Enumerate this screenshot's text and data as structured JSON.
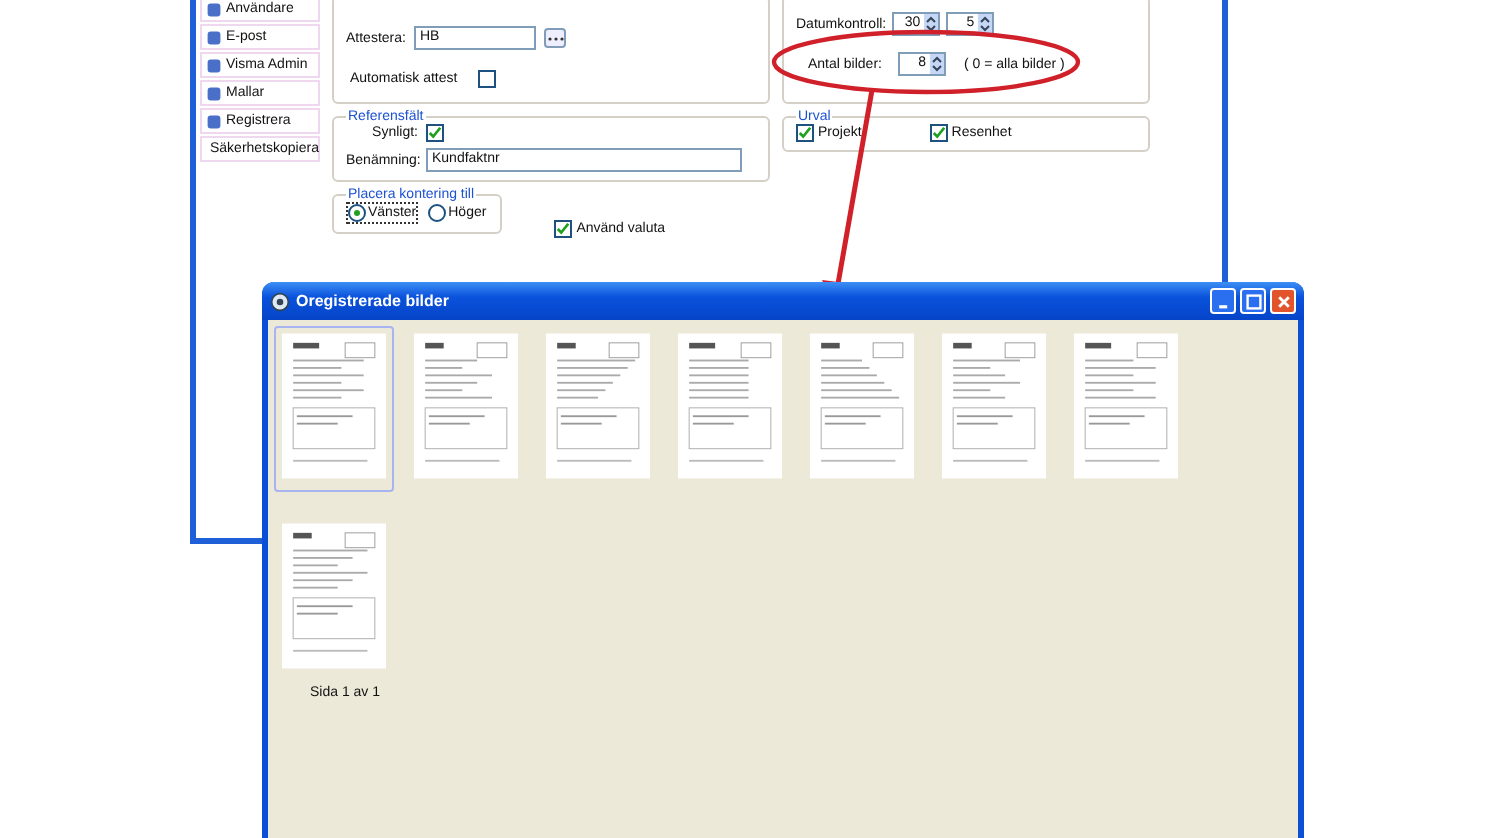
{
  "back_window": {
    "sidebar": {
      "items": [
        {
          "label": "Användare"
        },
        {
          "label": "E-post"
        },
        {
          "label": "Visma Admin"
        },
        {
          "label": "Mallar"
        },
        {
          "label": "Registrera"
        },
        {
          "label": "Säkerhetskopiera"
        }
      ]
    },
    "attest": {
      "attestera_label": "Attestera:",
      "attestera_value": "HB",
      "automatisk_label": "Automatisk attest",
      "automatisk_checked": false
    },
    "referensfalt": {
      "title": "Referensfält",
      "synligt_label": "Synligt:",
      "synligt_checked": true,
      "benamning_label": "Benämning:",
      "benamning_value": "Kundfaktnr"
    },
    "placera_kontering": {
      "title": "Placera kontering till",
      "options": [
        {
          "label": "Vänster",
          "selected": true
        },
        {
          "label": "Höger",
          "selected": false
        }
      ]
    },
    "anvand_valuta": {
      "label": "Använd valuta",
      "checked": true
    },
    "bilder": {
      "datumkontroll_label": "Datumkontroll:",
      "datumkontroll_values": [
        "30",
        "5"
      ],
      "antal_label": "Antal bilder:",
      "antal_value": "8",
      "antal_hint": "( 0 = alla bilder )"
    },
    "urval": {
      "title": "Urval",
      "items": [
        {
          "label": "Projekt",
          "checked": true
        },
        {
          "label": "Resenhet",
          "checked": true
        }
      ]
    }
  },
  "front_window": {
    "title": "Oregistrerade bilder",
    "thumbnails": [
      {
        "selected": true
      },
      {
        "selected": false
      },
      {
        "selected": false
      },
      {
        "selected": false
      },
      {
        "selected": false
      },
      {
        "selected": false
      },
      {
        "selected": false
      },
      {
        "selected": false
      }
    ],
    "page_label": "Sida 1 av 1"
  }
}
